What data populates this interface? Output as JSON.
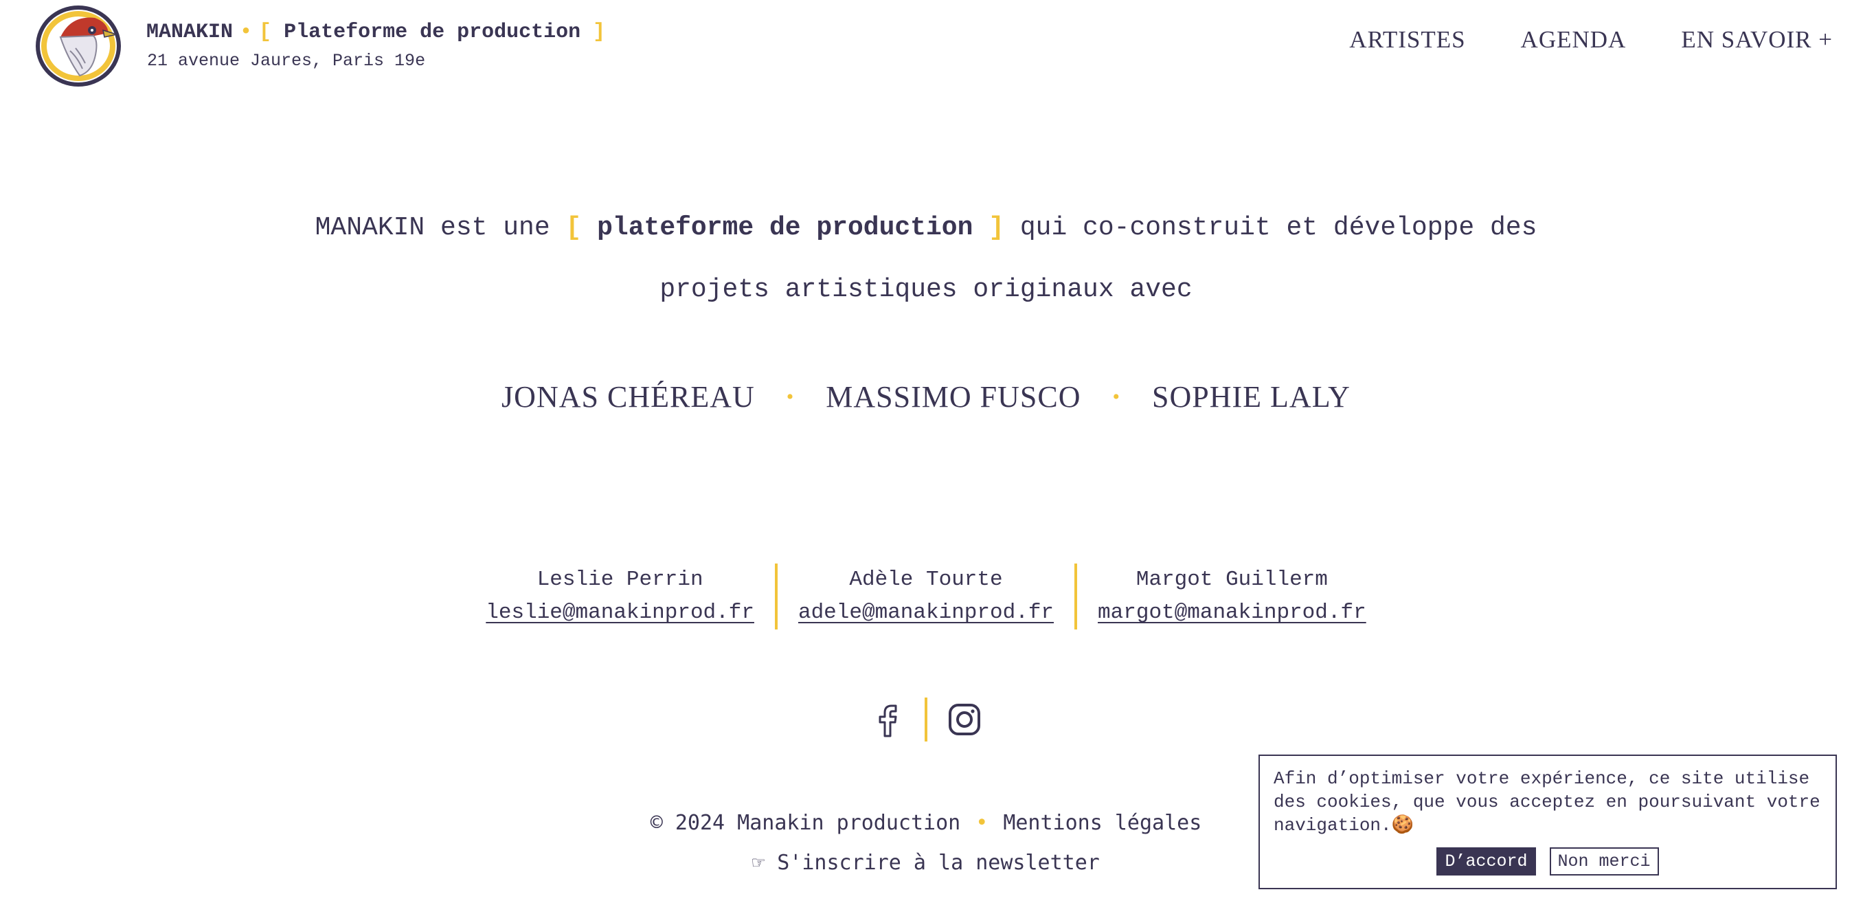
{
  "header": {
    "brand_name": "MANAKIN",
    "brand_dot": "•",
    "bracket_open": "[",
    "tagline": "Plateforme de production",
    "bracket_close": "]",
    "address": "21 avenue Jaures, Paris 19e",
    "nav": [
      "ARTISTES",
      "AGENDA",
      "EN SAVOIR +"
    ]
  },
  "intro": {
    "prefix": "MANAKIN est une",
    "bracket_open": "[",
    "highlight": "plateforme de production",
    "bracket_close": "]",
    "suffix": "qui co-construit et développe des",
    "line2": "projets artistiques originaux avec"
  },
  "artists": [
    "JONAS CHÉREAU",
    "MASSIMO FUSCO",
    "SOPHIE LALY"
  ],
  "artist_separator": "•",
  "contacts": [
    {
      "name": "Leslie Perrin",
      "email": "leslie@manakinprod.fr"
    },
    {
      "name": "Adèle Tourte",
      "email": "adele@manakinprod.fr"
    },
    {
      "name": "Margot Guillerm",
      "email": "margot@manakinprod.fr"
    }
  ],
  "social": {
    "facebook_icon": "facebook-icon",
    "instagram_icon": "instagram-icon"
  },
  "footer": {
    "copyright": "© 2024 Manakin production",
    "dot": "•",
    "legal": "Mentions légales",
    "newsletter": "☞ S'inscrire à la newsletter"
  },
  "cookie": {
    "message": "Afin d’optimiser votre expérience, ce site utilise des cookies, que vous acceptez en poursuivant votre navigation.🍪",
    "accept": "D’accord",
    "decline": "Non merci"
  },
  "colors": {
    "text": "#3a3553",
    "accent": "#f2c43a",
    "background": "#ffffff"
  }
}
